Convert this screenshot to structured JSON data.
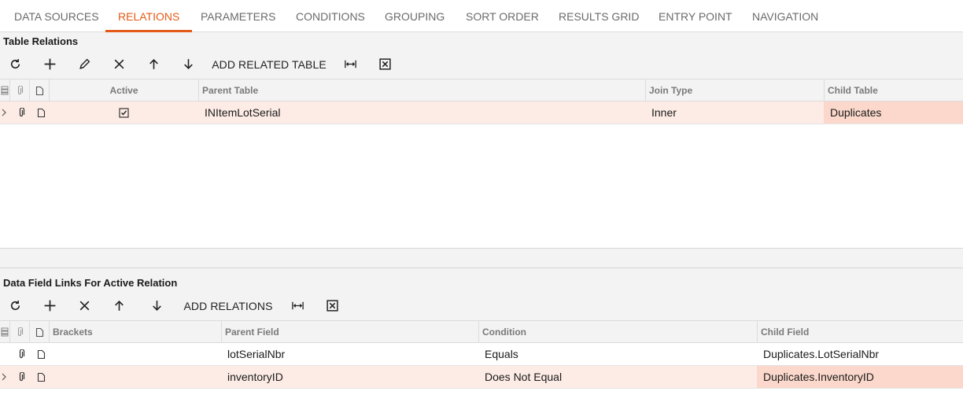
{
  "tabs": [
    {
      "label": "DATA SOURCES",
      "active": false
    },
    {
      "label": "RELATIONS",
      "active": true
    },
    {
      "label": "PARAMETERS",
      "active": false
    },
    {
      "label": "CONDITIONS",
      "active": false
    },
    {
      "label": "GROUPING",
      "active": false
    },
    {
      "label": "SORT ORDER",
      "active": false
    },
    {
      "label": "RESULTS GRID",
      "active": false
    },
    {
      "label": "ENTRY POINT",
      "active": false
    },
    {
      "label": "NAVIGATION",
      "active": false
    }
  ],
  "colors": {
    "accent": "#e35b16",
    "selected_row": "#fdece6",
    "highlight_cell": "#fbd8cb",
    "header_bg": "#f3f3f3"
  },
  "table_relations": {
    "title": "Table Relations",
    "toolbar": {
      "icons": [
        "refresh-icon",
        "add-icon",
        "edit-icon",
        "delete-icon",
        "move-up-icon",
        "move-down-icon",
        "fit-columns-icon",
        "excel-export-icon"
      ],
      "add_related_label": "ADD RELATED TABLE"
    },
    "columns": {
      "active": "Active",
      "parent_table": "Parent Table",
      "join_type": "Join Type",
      "child_table": "Child Table"
    },
    "rows": [
      {
        "active": true,
        "parent_table": "INItemLotSerial",
        "join_type": "Inner",
        "child_table": "Duplicates",
        "selected": true
      }
    ]
  },
  "data_field_links": {
    "title": "Data Field Links For Active Relation",
    "toolbar": {
      "icons": [
        "refresh-icon",
        "add-icon",
        "delete-icon",
        "move-up-icon",
        "move-down-icon",
        "fit-columns-icon",
        "excel-export-icon"
      ],
      "add_relations_label": "ADD RELATIONS"
    },
    "columns": {
      "brackets": "Brackets",
      "parent_field": "Parent Field",
      "condition": "Condition",
      "child_field": "Child Field"
    },
    "rows": [
      {
        "brackets": "",
        "parent_field": "lotSerialNbr",
        "condition": "Equals",
        "child_field": "Duplicates.LotSerialNbr",
        "selected": false
      },
      {
        "brackets": "",
        "parent_field": "inventoryID",
        "condition": "Does Not Equal",
        "child_field": "Duplicates.InventoryID",
        "selected": true
      }
    ]
  }
}
